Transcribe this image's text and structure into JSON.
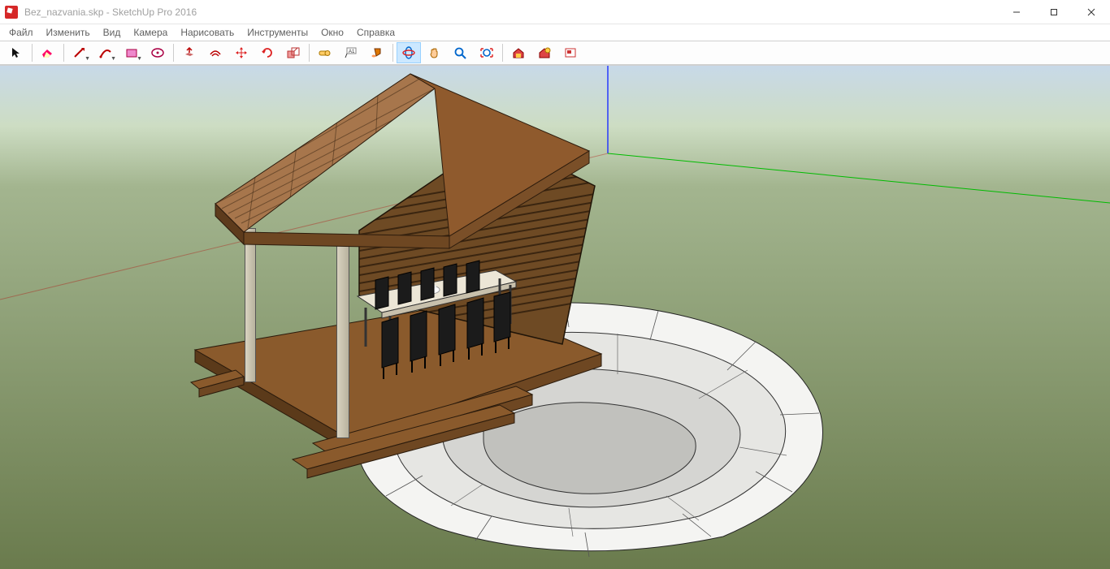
{
  "title": "Bez_nazvania.skp - SketchUp Pro 2016",
  "menu": {
    "file": "Файл",
    "edit": "Изменить",
    "view": "Вид",
    "camera": "Камера",
    "draw": "Нарисовать",
    "tools": "Инструменты",
    "window": "Окно",
    "help": "Справка"
  },
  "toolbar_icons": {
    "select": "select",
    "eraser": "eraser",
    "line": "line",
    "arc": "arc",
    "rectangle": "rectangle",
    "circle": "circle",
    "pushpull": "pushpull",
    "offset": "offset",
    "move": "move",
    "rotate": "rotate",
    "scale": "scale",
    "tape": "tape",
    "text": "text",
    "paint": "paint",
    "orbit": "orbit",
    "pan": "pan",
    "zoom": "zoom",
    "zoom_extents": "zoom-extents",
    "warehouse": "warehouse",
    "ext_warehouse": "ext-warehouse",
    "layout": "layout"
  }
}
